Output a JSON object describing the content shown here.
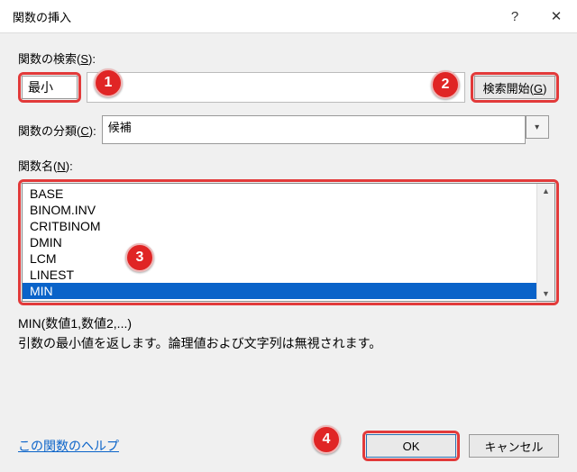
{
  "titlebar": {
    "title": "関数の挿入"
  },
  "search": {
    "label_prefix": "関数の検索(",
    "label_accel": "S",
    "label_suffix": "):",
    "value": "最小",
    "go_prefix": "検索開始(",
    "go_accel": "G",
    "go_suffix": ")"
  },
  "category": {
    "label_prefix": "関数の分類(",
    "label_accel": "C",
    "label_suffix": "):",
    "selected": "候補"
  },
  "functions": {
    "label_prefix": "関数名(",
    "label_accel": "N",
    "label_suffix": "):",
    "items": [
      "BASE",
      "BINOM.INV",
      "CRITBINOM",
      "DMIN",
      "LCM",
      "LINEST",
      "MIN"
    ],
    "selected_index": 6
  },
  "detail": {
    "syntax": "MIN(数値1,数値2,...)",
    "description": "引数の最小値を返します。論理値および文字列は無視されます。"
  },
  "footer": {
    "help": "この関数のヘルプ",
    "ok": "OK",
    "cancel": "キャンセル"
  },
  "badges": {
    "b1": "1",
    "b2": "2",
    "b3": "3",
    "b4": "4"
  }
}
